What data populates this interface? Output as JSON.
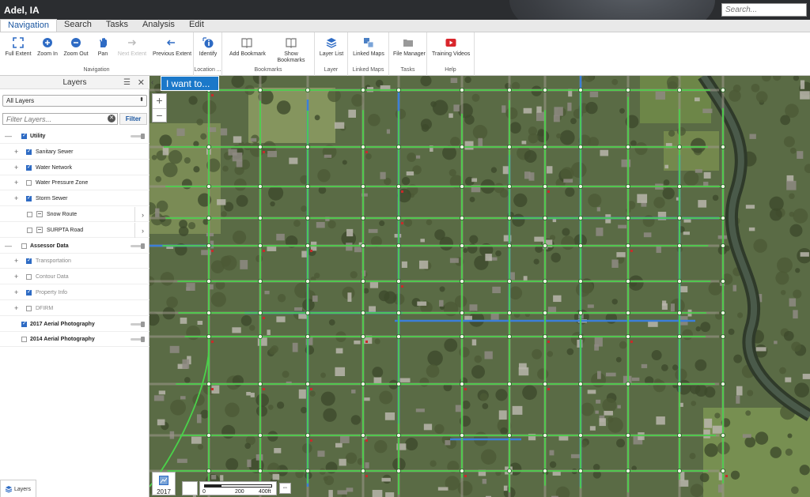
{
  "app": {
    "title": "Adel, IA",
    "search_placeholder": "Search..."
  },
  "menu": {
    "tabs": [
      "Navigation",
      "Search",
      "Tasks",
      "Analysis",
      "Edit"
    ],
    "active": "Navigation"
  },
  "ribbon": {
    "navigation": {
      "group_label": "Navigation",
      "buttons": [
        "Full Extent",
        "Zoom In",
        "Zoom Out",
        "Pan",
        "Next Extent",
        "Previous Extent"
      ]
    },
    "location": {
      "group_label": "Location ...",
      "buttons": [
        "Identify"
      ]
    },
    "bookmarks": {
      "group_label": "Bookmarks",
      "buttons": [
        "Add Bookmark",
        "Show",
        "Bookmarks"
      ]
    },
    "layer": {
      "group_label": "Layer",
      "buttons": [
        "Layer List"
      ]
    },
    "linked_maps": {
      "group_label": "Linked Maps",
      "buttons": [
        "Linked Maps"
      ]
    },
    "tasks": {
      "group_label": "Tasks",
      "buttons": [
        "File Manager"
      ]
    },
    "help": {
      "group_label": "Help",
      "buttons": [
        "Training Videos"
      ]
    }
  },
  "layers_panel": {
    "title": "Layers",
    "select_value": "All Layers",
    "filter_placeholder": "Filter Layers...",
    "filter_button": "Filter",
    "items": [
      {
        "label": "Utility",
        "expander": "—",
        "checked": true,
        "bold": true,
        "slider": true
      },
      {
        "label": "Sanitary Sewer",
        "expander": "+",
        "checked": true
      },
      {
        "label": "Water Network",
        "expander": "+",
        "checked": true
      },
      {
        "label": "Water Pressure Zone",
        "expander": "+",
        "checked": false
      },
      {
        "label": "Storm Sewer",
        "expander": "+",
        "checked": true
      },
      {
        "label": "Snow Route",
        "checked": false,
        "chevron": "›"
      },
      {
        "label": "SURPTA Road",
        "checked": false,
        "chevron": "›"
      },
      {
        "label": "Assessor Data",
        "expander": "—",
        "checked": false,
        "bold": true,
        "slider": true
      },
      {
        "label": "Transportation",
        "expander": "+",
        "checked": true,
        "dim": true
      },
      {
        "label": "Contour Data",
        "expander": "+",
        "checked": false,
        "dim": true
      },
      {
        "label": "Property Info",
        "expander": "+",
        "checked": true,
        "dim": true
      },
      {
        "label": "DFIRM",
        "expander": "+",
        "checked": false,
        "dim": true
      },
      {
        "label": "2017 Aerial Photography",
        "checked": true,
        "bold": true,
        "slider": true
      },
      {
        "label": "2014 Aerial Photography",
        "checked": false,
        "bold": true,
        "slider": true
      }
    ],
    "bottom_tab": "Layers"
  },
  "map": {
    "i_want_to": "I want to...",
    "zoom_in": "+",
    "zoom_out": "−",
    "basemap_label": "2017",
    "scale_ticks": [
      "0",
      "200",
      "400ft"
    ],
    "colors": {
      "sewer": "#4ad14a",
      "storm": "#3b7fd9",
      "aerial": "#5a6b45"
    }
  }
}
